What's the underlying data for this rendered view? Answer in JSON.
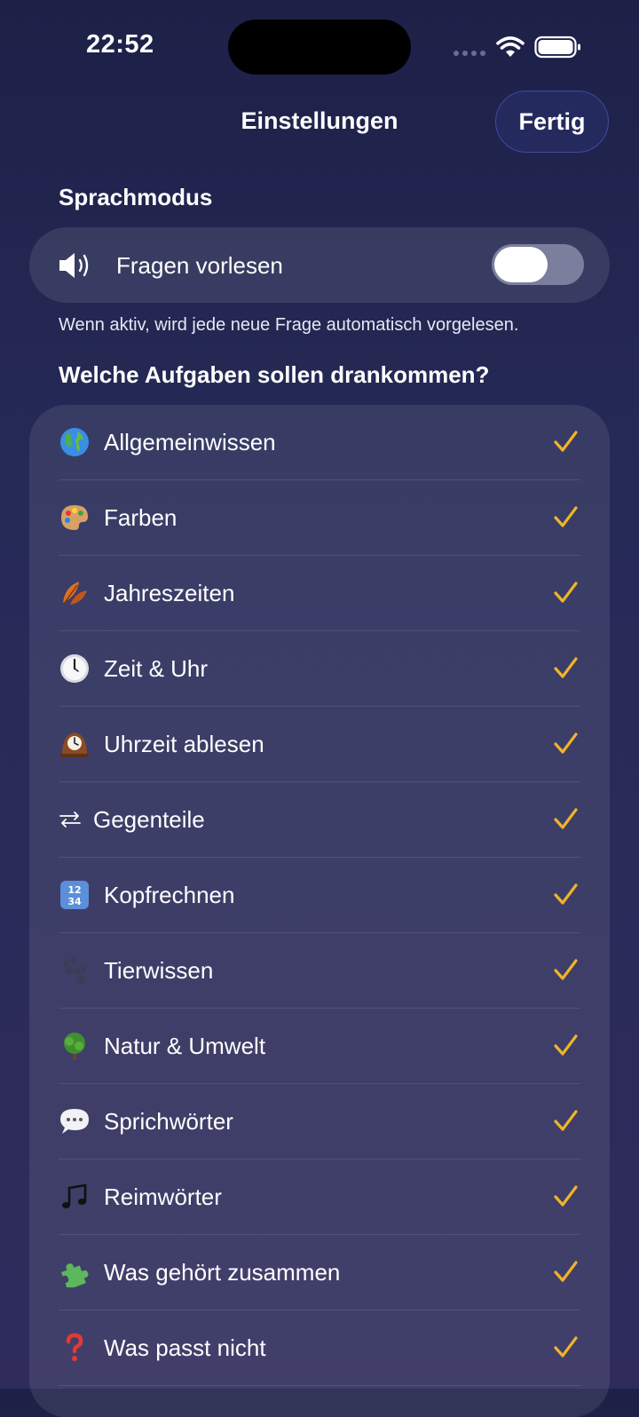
{
  "status_bar": {
    "time": "22:52"
  },
  "nav": {
    "title": "Einstellungen",
    "done_label": "Fertig"
  },
  "voice_mode": {
    "heading": "Sprachmodus",
    "toggle_label": "Fragen vorlesen",
    "toggle_on": false,
    "note": "Wenn aktiv, wird jede neue Frage automatisch vorgelesen."
  },
  "tasks": {
    "heading": "Welche Aufgaben sollen drankommen?",
    "items": [
      {
        "label": "Allgemeinwissen",
        "icon": "globe-icon",
        "checked": true
      },
      {
        "label": "Farben",
        "icon": "palette-icon",
        "checked": true
      },
      {
        "label": "Jahreszeiten",
        "icon": "leaves-icon",
        "checked": true
      },
      {
        "label": "Zeit & Uhr",
        "icon": "clock-icon",
        "checked": true
      },
      {
        "label": "Uhrzeit ablesen",
        "icon": "mantel-clock-icon",
        "checked": true
      },
      {
        "label": "Gegenteile",
        "icon": "arrows-swap-icon",
        "checked": true
      },
      {
        "label": "Kopfrechnen",
        "icon": "numbers-icon",
        "checked": true
      },
      {
        "label": "Tierwissen",
        "icon": "paw-icon",
        "checked": true
      },
      {
        "label": "Natur & Umwelt",
        "icon": "tree-icon",
        "checked": true
      },
      {
        "label": "Sprichwörter",
        "icon": "speech-bubble-icon",
        "checked": true
      },
      {
        "label": "Reimwörter",
        "icon": "music-note-icon",
        "checked": true
      },
      {
        "label": "Was gehört zusammen",
        "icon": "puzzle-icon",
        "checked": true
      },
      {
        "label": "Was passt nicht",
        "icon": "question-mark-icon",
        "checked": true
      }
    ]
  },
  "colors": {
    "accent_check": "#f0b429",
    "done_border": "#3d4a9c"
  }
}
